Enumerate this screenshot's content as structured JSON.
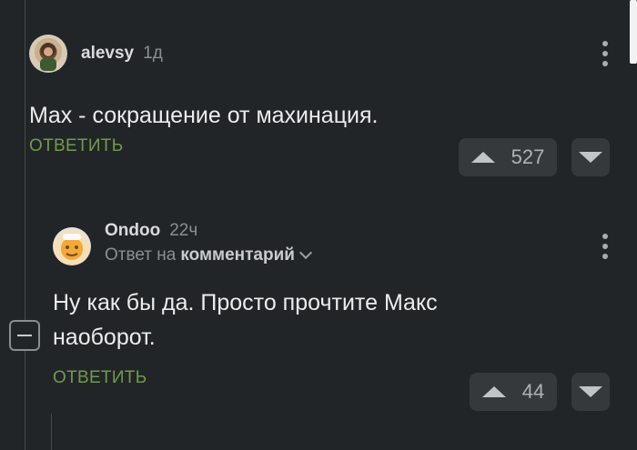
{
  "comments": [
    {
      "username": "alevsy",
      "time": "1д",
      "text": "Max - сокращение от махинация.",
      "reply_label": "ОТВЕТИТЬ",
      "rating": "527"
    },
    {
      "username": "Ondoo",
      "time": "22ч",
      "reply_to_prefix": "Ответ на",
      "reply_to_link": "комментарий",
      "text": "Ну как бы да. Просто прочтите Макс наоборот.",
      "reply_label": "ОТВЕТИТЬ",
      "rating": "44"
    }
  ],
  "colors": {
    "background": "#222527",
    "reply_green": "#6f9b4b",
    "vote_button": "#35393c"
  },
  "icons": [
    "kebab-menu-icon",
    "arrow-up-icon",
    "arrow-down-icon",
    "collapse-minus-icon",
    "chevron-down-icon"
  ]
}
